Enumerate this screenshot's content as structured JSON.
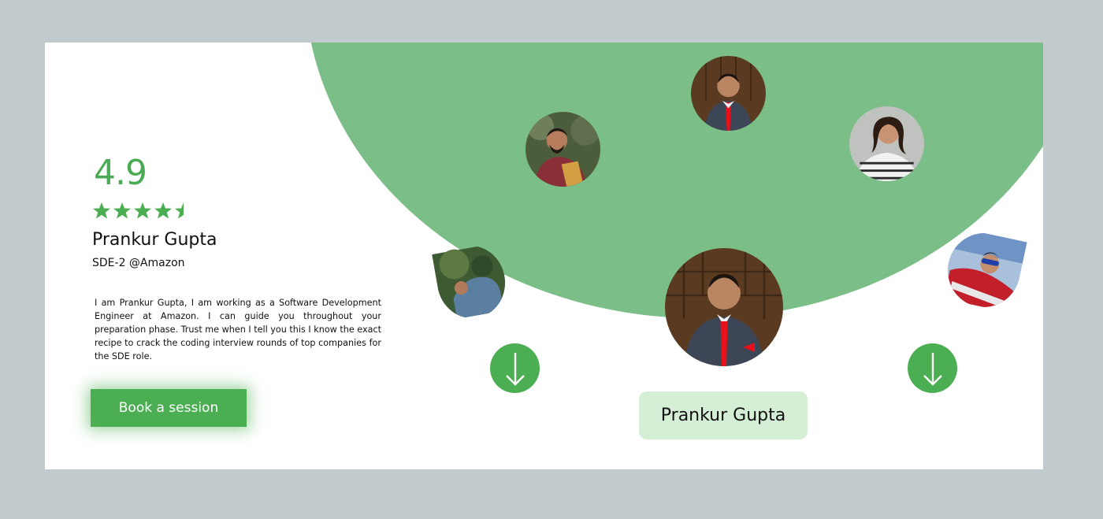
{
  "profile": {
    "rating": "4.9",
    "stars": 4.5,
    "name": "Prankur Gupta",
    "role": "SDE-2 @Amazon",
    "bio": "I am Prankur Gupta, I am working as a Software Development Engineer at Amazon. I can guide you throughout your preparation phase. Trust me when I tell you this I know the exact recipe to crack the coding interview rounds of top companies for the SDE role.",
    "cta_label": "Book a session"
  },
  "carousel": {
    "selected_name": "Prankur Gupta",
    "prev_icon": "arrow-down-icon",
    "next_icon": "arrow-down-icon"
  },
  "colors": {
    "accent": "#4cae52",
    "blob": "#7bbe87",
    "pill": "#d5efd7",
    "background": "#c1cacd"
  }
}
